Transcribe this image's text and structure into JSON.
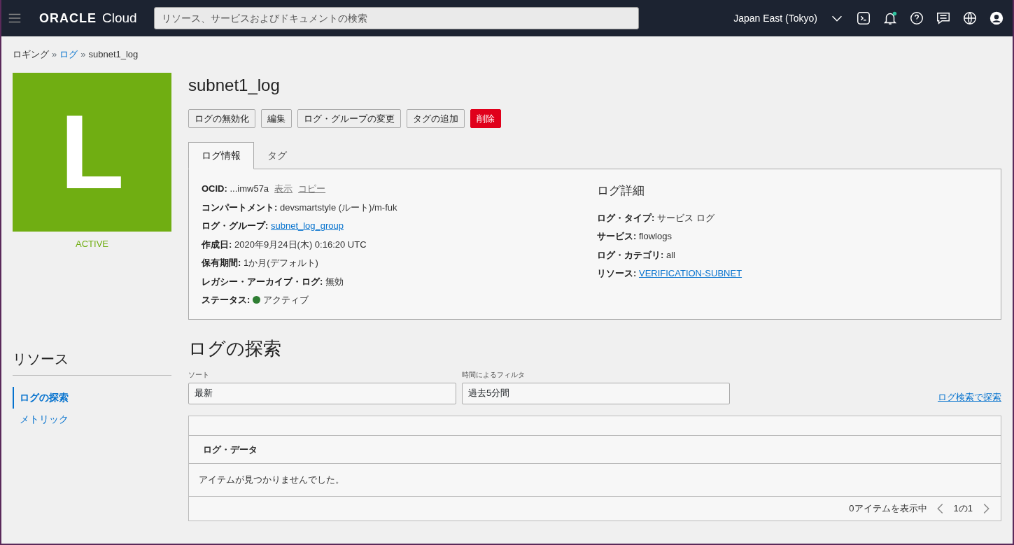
{
  "header": {
    "logo_brand": "ORACLE",
    "logo_product": "Cloud",
    "search": {
      "placeholder": "リソース、サービスおよびドキュメントの検索"
    },
    "region": "Japan East (Tokyo)",
    "notifications_unread": true
  },
  "breadcrumb_separator": "»",
  "breadcrumb": [
    {
      "label": "ロギング",
      "link": false
    },
    {
      "label": "ログ",
      "link": true
    },
    {
      "label": "subnet1_log",
      "link": false
    }
  ],
  "resource_icon": {
    "letter": "L",
    "state": "ACTIVE"
  },
  "title": "subnet1_log",
  "actions": [
    {
      "label": "ログの無効化",
      "kind": "default"
    },
    {
      "label": "編集",
      "kind": "default"
    },
    {
      "label": "ログ・グループの変更",
      "kind": "default"
    },
    {
      "label": "タグの追加",
      "kind": "default"
    },
    {
      "label": "削除",
      "kind": "danger"
    }
  ],
  "tabs": [
    {
      "label": "ログ情報",
      "selected": true
    },
    {
      "label": "タグ",
      "selected": false
    }
  ],
  "info": [
    {
      "kind": "ocid",
      "label": "OCID:",
      "value": "...imw57a",
      "links": [
        "表示",
        "コピー"
      ]
    },
    {
      "kind": "text",
      "label": "コンパートメント:",
      "value": "devsmartstyle (ルート)/m-fuk"
    },
    {
      "kind": "link",
      "label": "ログ・グループ:",
      "value": "subnet_log_group"
    },
    {
      "kind": "text",
      "label": "作成日:",
      "value": "2020年9月24日(木) 0:16:20 UTC"
    },
    {
      "kind": "text",
      "label": "保有期間:",
      "value": "1か月(デフォルト)"
    },
    {
      "kind": "text",
      "label": "レガシー・アーカイブ・ログ:",
      "value": "無効"
    },
    {
      "kind": "status",
      "label": "ステータス:",
      "value": "アクティブ",
      "color": "#2e7d32"
    }
  ],
  "details": {
    "title": "ログ詳細",
    "fields": [
      {
        "kind": "text",
        "label": "ログ・タイプ:",
        "value": "サービス ログ"
      },
      {
        "kind": "text",
        "label": "サービス:",
        "value": "flowlogs"
      },
      {
        "kind": "text",
        "label": "ログ・カテゴリ:",
        "value": "all"
      },
      {
        "kind": "link",
        "label": "リソース:",
        "value": "VERIFICATION-SUBNET"
      }
    ]
  },
  "resources": {
    "title": "リソース",
    "items": [
      {
        "label": "ログの探索",
        "selected": true
      },
      {
        "label": "メトリック",
        "selected": false
      }
    ]
  },
  "explore": {
    "title": "ログの探索",
    "sort": {
      "label": "ソート",
      "value": "最新"
    },
    "filter": {
      "label": "時間によるフィルタ",
      "value": "過去5分間"
    },
    "search_link": "ログ検索で探索",
    "table": {
      "columns": [
        "ログ・データ"
      ],
      "empty_message": "アイテムが見つかりませんでした。",
      "count": "0アイテムを表示中",
      "page": "1の1"
    }
  }
}
